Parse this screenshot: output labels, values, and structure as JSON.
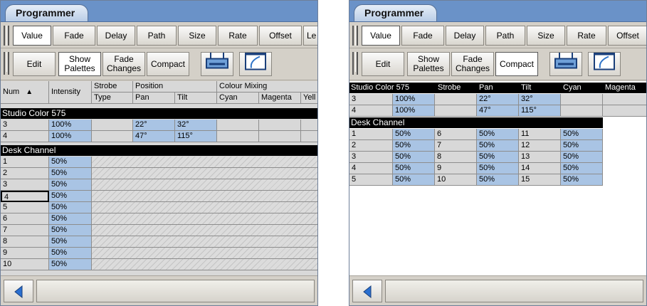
{
  "left": {
    "title": "Programmer",
    "toolbar1": [
      "Value",
      "Fade",
      "Delay",
      "Path",
      "Size",
      "Rate",
      "Offset",
      "Le"
    ],
    "toolbar2": {
      "edit": "Edit",
      "show_palettes": [
        "Show",
        "Palettes"
      ],
      "fade_changes": [
        "Fade",
        "Changes"
      ],
      "compact": "Compact"
    },
    "header": {
      "num": "Num",
      "sort_arrow": "▲",
      "intensity": "Intensity",
      "strobe": "Strobe",
      "strobe_sub": "Type",
      "position": "Position",
      "pan": "Pan",
      "tilt": "Tilt",
      "colour": "Colour Mixing",
      "cyan": "Cyan",
      "magenta": "Magenta",
      "yellow": "Yell"
    },
    "section1": "Studio Color 575",
    "studio_rows": [
      {
        "num": "3",
        "intensity": "100%",
        "pan": "22°",
        "tilt": "32°"
      },
      {
        "num": "4",
        "intensity": "100%",
        "pan": "47°",
        "tilt": "115°"
      }
    ],
    "section2": "Desk Channel",
    "desk_rows": [
      {
        "num": "1",
        "intensity": "50%"
      },
      {
        "num": "2",
        "intensity": "50%"
      },
      {
        "num": "3",
        "intensity": "50%"
      },
      {
        "num": "4",
        "intensity": "50%"
      },
      {
        "num": "5",
        "intensity": "50%"
      },
      {
        "num": "6",
        "intensity": "50%"
      },
      {
        "num": "7",
        "intensity": "50%"
      },
      {
        "num": "8",
        "intensity": "50%"
      },
      {
        "num": "9",
        "intensity": "50%"
      },
      {
        "num": "10",
        "intensity": "50%"
      }
    ]
  },
  "right": {
    "title": "Programmer",
    "toolbar1": [
      "Value",
      "Fade",
      "Delay",
      "Path",
      "Size",
      "Rate",
      "Offset"
    ],
    "toolbar2": {
      "edit": "Edit",
      "show_palettes": [
        "Show",
        "Palettes"
      ],
      "fade_changes": [
        "Fade",
        "Changes"
      ],
      "compact": "Compact"
    },
    "section1_header": {
      "label": "Studio Color 575",
      "strobe": "Strobe",
      "pan": "Pan",
      "tilt": "Tilt",
      "cyan": "Cyan",
      "magenta": "Magenta"
    },
    "studio_rows": [
      {
        "num": "3",
        "intensity": "100%",
        "pan": "22°",
        "tilt": "32°"
      },
      {
        "num": "4",
        "intensity": "100%",
        "pan": "47°",
        "tilt": "115°"
      }
    ],
    "section2": "Desk Channel",
    "desk_rows": [
      {
        "a": "1",
        "b": "50%",
        "c": "6",
        "d": "50%",
        "e": "11",
        "f": "50%"
      },
      {
        "a": "2",
        "b": "50%",
        "c": "7",
        "d": "50%",
        "e": "12",
        "f": "50%"
      },
      {
        "a": "3",
        "b": "50%",
        "c": "8",
        "d": "50%",
        "e": "13",
        "f": "50%"
      },
      {
        "a": "4",
        "b": "50%",
        "c": "9",
        "d": "50%",
        "e": "14",
        "f": "50%"
      },
      {
        "a": "5",
        "b": "50%",
        "c": "10",
        "d": "50%",
        "e": "15",
        "f": "50%"
      }
    ]
  },
  "colors": {
    "title_bar": "#6a92c8",
    "value_cell": "#a9c4e4",
    "label_cell": "#d8d8d8",
    "section": "#000000"
  }
}
